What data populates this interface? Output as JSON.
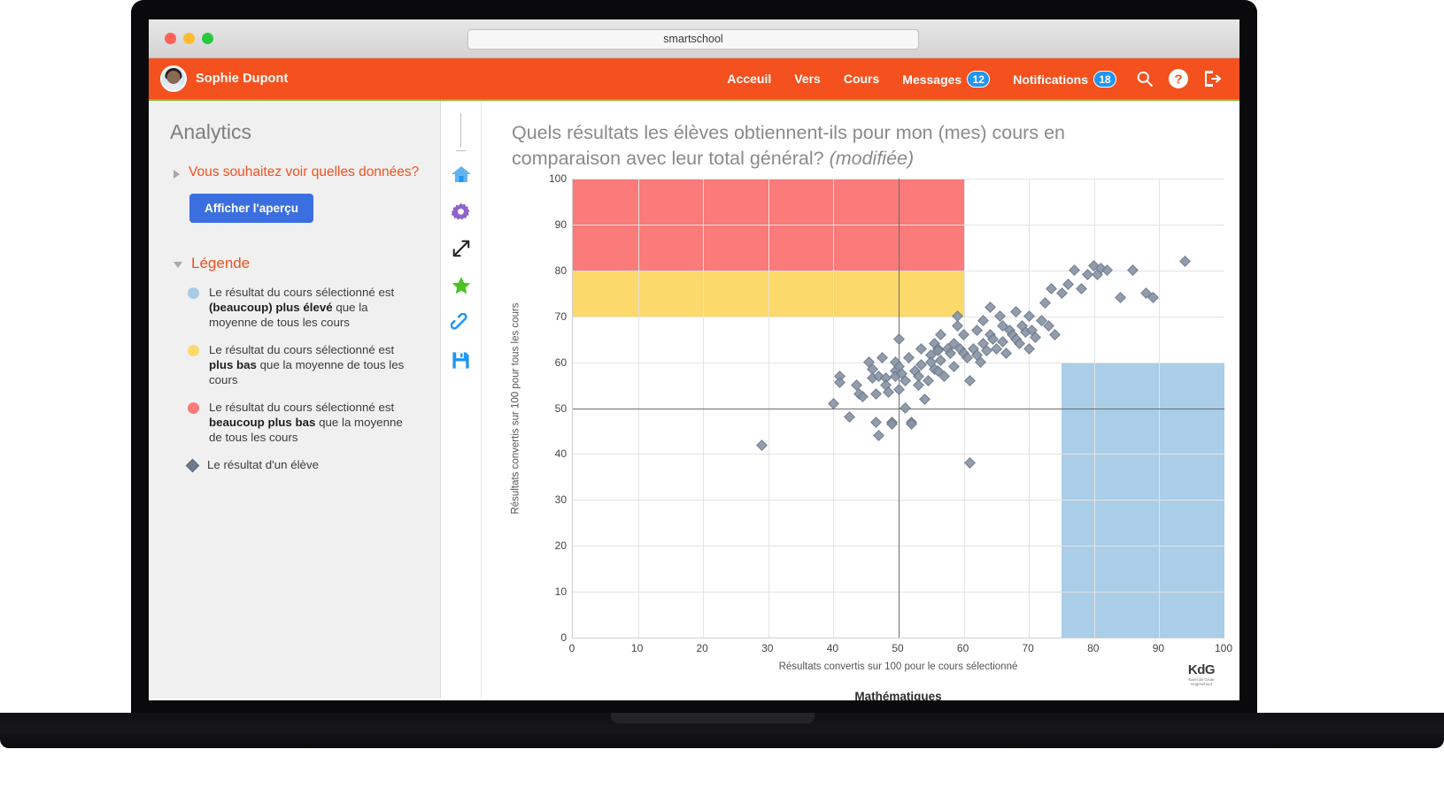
{
  "browser": {
    "url": "smartschool",
    "traffic_lights": [
      "close",
      "minimize",
      "zoom"
    ]
  },
  "appbar": {
    "user_name": "Sophie Dupont",
    "nav": [
      {
        "label": "Acceuil",
        "badge": null
      },
      {
        "label": "Vers",
        "badge": null
      },
      {
        "label": "Cours",
        "badge": null
      },
      {
        "label": "Messages",
        "badge": "12"
      },
      {
        "label": "Notifications",
        "badge": "18"
      }
    ],
    "icons": [
      "search-icon",
      "help-icon",
      "logout-icon"
    ],
    "brand_color": "#f4511e",
    "badge_color": "#2196f3"
  },
  "sidebar": {
    "title": "Analytics",
    "data_accordion_label": "Vous souhaitez voir quelles données?",
    "preview_button_label": "Afficher l'aperçu",
    "legend_accordion_label": "Légende",
    "legend_items": [
      {
        "marker": "circle",
        "color": "#a9cbe8",
        "text_parts": [
          "Le résultat du cours sélectionné est ",
          "(beaucoup) plus élevé",
          " que la moyenne de tous les cours"
        ]
      },
      {
        "marker": "circle",
        "color": "#fbd96b",
        "text_parts": [
          "Le résultat du cours sélectionné est ",
          "plus bas",
          " que la moyenne de tous les cours"
        ]
      },
      {
        "marker": "circle",
        "color": "#fb7a7a",
        "text_parts": [
          "Le résultat du cours sélectionné est ",
          "beaucoup plus bas",
          " que la moyenne de tous les cours"
        ]
      },
      {
        "marker": "diamond",
        "color": "#6e7b8c",
        "text_parts": [
          "Le résultat d'un élève",
          "",
          ""
        ]
      }
    ]
  },
  "icon_rail": [
    "home-icon",
    "gear-icon",
    "expand-icon",
    "star-icon",
    "link-icon",
    "save-icon"
  ],
  "main": {
    "title_line1": "Quels résultats les élèves obtiennent-ils pour mon (mes) cours en",
    "title_line2": "comparaison avec leur total général?",
    "title_modifier": "(modifiée)",
    "logo_main": "KdG",
    "logo_sub": "Karel de Grote Hogeschool"
  },
  "chart_data": {
    "type": "scatter",
    "title": "Mathématiques",
    "xlabel": "Résultats convertis sur 100 pour le cours sélectionné",
    "ylabel": "Résultats convertis sur 100 pour tous les cours",
    "xlim": [
      0,
      100
    ],
    "ylim": [
      0,
      100
    ],
    "xticks": [
      0,
      10,
      20,
      30,
      40,
      50,
      60,
      70,
      80,
      90,
      100
    ],
    "yticks": [
      0,
      10,
      20,
      30,
      40,
      50,
      60,
      70,
      80,
      90,
      100
    ],
    "grid": true,
    "legend_position": "sidebar",
    "mean_lines": {
      "x": 50,
      "y": 50,
      "color": "#6d6d6d"
    },
    "zones": [
      {
        "name": "much-lower-red",
        "color": "#fb7a7a",
        "x0": 0,
        "x1": 60,
        "y0": 80,
        "y1": 100
      },
      {
        "name": "lower-yellow",
        "color": "#fbd96b",
        "x0": 0,
        "x1": 60,
        "y0": 70,
        "y1": 80
      },
      {
        "name": "much-higher-blue",
        "color": "#aacde8",
        "x0": 75,
        "x1": 100,
        "y0": 0,
        "y1": 60
      }
    ],
    "series": [
      {
        "name": "Le résultat d'un élève",
        "marker": "diamond",
        "color": "#8995a5",
        "points": [
          [
            29,
            42
          ],
          [
            40,
            51
          ],
          [
            41,
            57
          ],
          [
            41,
            55.5
          ],
          [
            42.5,
            48
          ],
          [
            43.5,
            55
          ],
          [
            44,
            53
          ],
          [
            44.5,
            52.5
          ],
          [
            45.5,
            60
          ],
          [
            46,
            58.5
          ],
          [
            46,
            56.5
          ],
          [
            46.5,
            53
          ],
          [
            46.5,
            47
          ],
          [
            47,
            44
          ],
          [
            47,
            57
          ],
          [
            47.5,
            61
          ],
          [
            48,
            56.5
          ],
          [
            48,
            55
          ],
          [
            48.5,
            53.5
          ],
          [
            49,
            47
          ],
          [
            49,
            46.5
          ],
          [
            49.5,
            60
          ],
          [
            49.5,
            58
          ],
          [
            49.5,
            57
          ],
          [
            50,
            65
          ],
          [
            50,
            59
          ],
          [
            50,
            54
          ],
          [
            50.5,
            57.5
          ],
          [
            51,
            50
          ],
          [
            51,
            56
          ],
          [
            51.5,
            61
          ],
          [
            52,
            47
          ],
          [
            52,
            46.5
          ],
          [
            52.5,
            58
          ],
          [
            53,
            57
          ],
          [
            53,
            55
          ],
          [
            53.5,
            63
          ],
          [
            53.5,
            59.5
          ],
          [
            54,
            52
          ],
          [
            54.5,
            56
          ],
          [
            55,
            61.5
          ],
          [
            55,
            60
          ],
          [
            55.5,
            64
          ],
          [
            55.5,
            58.5
          ],
          [
            56,
            63
          ],
          [
            56,
            62.5
          ],
          [
            56,
            58
          ],
          [
            56.5,
            66
          ],
          [
            56.5,
            60.5
          ],
          [
            57,
            57
          ],
          [
            57.5,
            63
          ],
          [
            58,
            62
          ],
          [
            58.5,
            64
          ],
          [
            58.5,
            59
          ],
          [
            59,
            70
          ],
          [
            59,
            68
          ],
          [
            59.5,
            63
          ],
          [
            60,
            66
          ],
          [
            60,
            62
          ],
          [
            60.5,
            61
          ],
          [
            61,
            56
          ],
          [
            61,
            38
          ],
          [
            61.5,
            63
          ],
          [
            62,
            67
          ],
          [
            62,
            61.5
          ],
          [
            62.5,
            60
          ],
          [
            63,
            69
          ],
          [
            63,
            64
          ],
          [
            63.5,
            62.5
          ],
          [
            64,
            72
          ],
          [
            64,
            66
          ],
          [
            64.5,
            65
          ],
          [
            65,
            63
          ],
          [
            65.5,
            70
          ],
          [
            66,
            68
          ],
          [
            66,
            64.5
          ],
          [
            66.5,
            62
          ],
          [
            67,
            67
          ],
          [
            67.5,
            66
          ],
          [
            68,
            71
          ],
          [
            68,
            65
          ],
          [
            68.5,
            64
          ],
          [
            69,
            68
          ],
          [
            69.5,
            66.5
          ],
          [
            70,
            70
          ],
          [
            70,
            63
          ],
          [
            70.5,
            67
          ],
          [
            71,
            65.5
          ],
          [
            72,
            69
          ],
          [
            72.5,
            73
          ],
          [
            73,
            68
          ],
          [
            73.5,
            76
          ],
          [
            74,
            66
          ],
          [
            75,
            75
          ],
          [
            76,
            77
          ],
          [
            77,
            80
          ],
          [
            78,
            76
          ],
          [
            79,
            79
          ],
          [
            80,
            81
          ],
          [
            80.5,
            79
          ],
          [
            81,
            80.5
          ],
          [
            82,
            80
          ],
          [
            84,
            74
          ],
          [
            86,
            80
          ],
          [
            88,
            75
          ],
          [
            89,
            74
          ],
          [
            94,
            82
          ]
        ]
      }
    ]
  }
}
